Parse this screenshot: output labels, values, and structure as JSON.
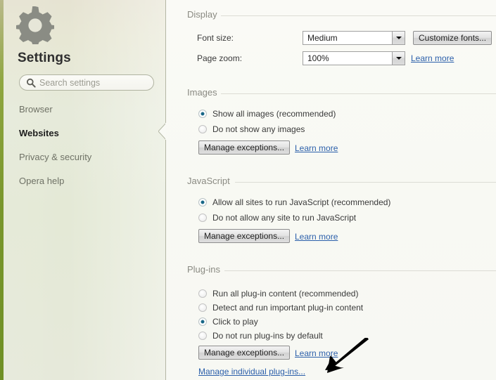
{
  "sidebar": {
    "gear_icon": "gear-icon",
    "title": "Settings",
    "search": {
      "placeholder": "Search settings",
      "value": "",
      "icon": "search-icon"
    },
    "items": [
      {
        "label": "Browser",
        "active": false
      },
      {
        "label": "Websites",
        "active": true
      },
      {
        "label": "Privacy & security",
        "active": false
      },
      {
        "label": "Opera help",
        "active": false
      }
    ]
  },
  "content": {
    "sections": [
      {
        "title": "Display",
        "rows": [
          {
            "label": "Font size:",
            "select_value": "Medium",
            "button": "Customize fonts..."
          },
          {
            "label": "Page zoom:",
            "select_value": "100%",
            "link": "Learn more"
          }
        ]
      },
      {
        "title": "Images",
        "options": [
          {
            "label": "Show all images (recommended)",
            "selected": true
          },
          {
            "label": "Do not show any images",
            "selected": false
          }
        ],
        "button": "Manage exceptions...",
        "link": "Learn more"
      },
      {
        "title": "JavaScript",
        "options": [
          {
            "label": "Allow all sites to run JavaScript (recommended)",
            "selected": true
          },
          {
            "label": "Do not allow any site to run JavaScript",
            "selected": false
          }
        ],
        "button": "Manage exceptions...",
        "link": "Learn more"
      },
      {
        "title": "Plug-ins",
        "options": [
          {
            "label": "Run all plug-in content (recommended)",
            "selected": false
          },
          {
            "label": "Detect and run important plug-in content",
            "selected": false
          },
          {
            "label": "Click to play",
            "selected": true
          },
          {
            "label": "Do not run plug-ins by default",
            "selected": false
          }
        ],
        "button": "Manage exceptions...",
        "link": "Learn more",
        "secondary_link": "Manage individual plug-ins..."
      }
    ]
  },
  "annotation": {
    "arrow": "arrow-pointing-down-left"
  },
  "colors": {
    "sidebar_edge_green": "#79962c",
    "sidebar_bg": "#e5e9d8",
    "content_bg": "#f8f9f3",
    "link": "#2b5faa",
    "radio_selected": "#15607f",
    "section_title": "#8a8a82"
  }
}
